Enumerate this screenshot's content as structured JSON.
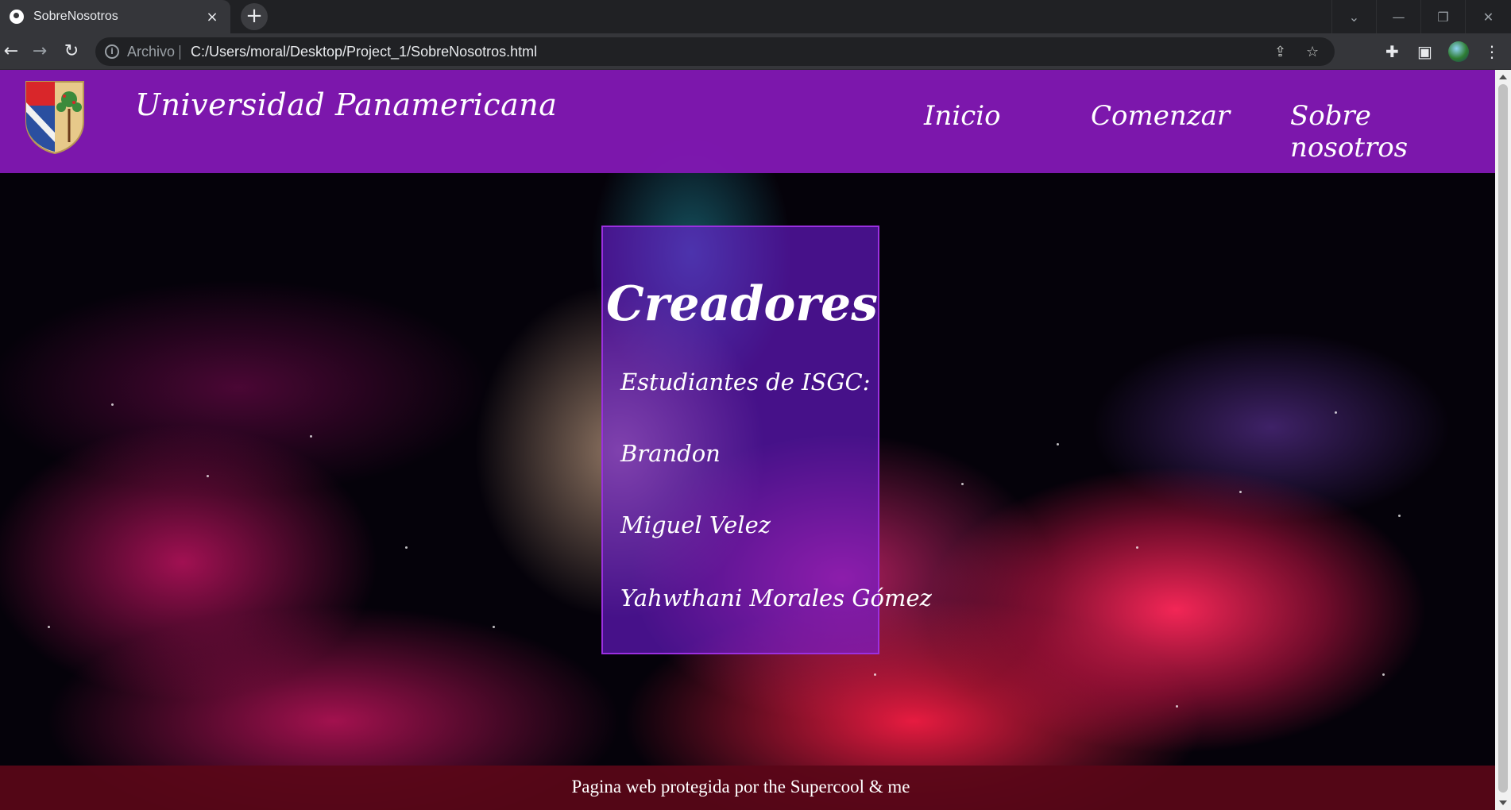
{
  "browser": {
    "tab_title": "SobreNosotros",
    "tab_close": "×",
    "new_tab": "+",
    "address_scheme": "Archivo",
    "address_url": "C:/Users/moral/Desktop/Project_1/SobreNosotros.html",
    "icons": [
      "globe-icon",
      "close-icon",
      "plus-icon",
      "chevron-down-icon",
      "minimize-icon",
      "restore-icon",
      "window-close-icon",
      "back-arrow-icon",
      "forward-arrow-icon",
      "reload-icon",
      "info-icon",
      "share-icon",
      "star-icon",
      "puzzle-icon",
      "sidepanel-icon",
      "profile-avatar",
      "kebab-menu-icon"
    ]
  },
  "site": {
    "brand": "Universidad Panamericana",
    "nav": {
      "home": "Inicio",
      "start": "Comenzar",
      "about": "Sobre nosotros"
    },
    "creators": {
      "heading": "Creadores",
      "subtitle": "Estudiantes de ISGC:",
      "names": [
        "Brandon",
        "Miguel Velez",
        "Yahwthani Morales Gómez"
      ]
    },
    "footer": "Pagina web protegida por the Supercool & me"
  },
  "colors": {
    "header_bg": "#8018b2",
    "card_bg": "#761ee6",
    "footer_bg": "#5a0618",
    "chrome_bg": "#35363a"
  }
}
